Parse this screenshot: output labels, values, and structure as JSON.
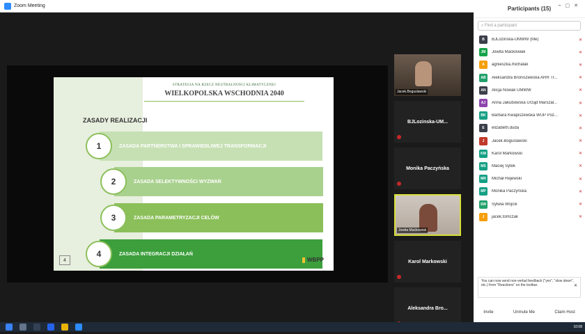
{
  "window": {
    "title": "Zoom Meeting"
  },
  "slide": {
    "subtitle": "STRATEGIA NA RZECZ NEUTRALNOŚCI KLIMATYCZNEJ",
    "title": "WIELKOPOLSKA WSCHODNIA 2040",
    "section": "ZASADY REALIZACJI",
    "items": [
      {
        "num": "1",
        "label": "ZASADA PARTNERSTWA I SPRAWIEDLIWEJ TRANSFORMACJI"
      },
      {
        "num": "2",
        "label": "ZASADA SELEKTYWNOŚCI WYZWAŃ"
      },
      {
        "num": "3",
        "label": "ZASADA PARAMETRYZACJI CELÓW"
      },
      {
        "num": "4",
        "label": "ZASADA INTEGRACJI DZIAŁAŃ"
      }
    ],
    "page_number": "4",
    "logo": "WBPP"
  },
  "tiles": [
    {
      "name": "Jacek.Boguslawski",
      "type": "video"
    },
    {
      "name": "BJLozinska-UM...",
      "type": "name"
    },
    {
      "name": "Monika Paczyńska",
      "type": "name"
    },
    {
      "name": "Jowita Maćkowiak",
      "type": "video"
    },
    {
      "name": "Karol Markowski",
      "type": "name"
    },
    {
      "name": "Aleksandra Bro...",
      "type": "name"
    }
  ],
  "participants_panel": {
    "title": "Participants (15)",
    "search_placeholder": "Find a participant",
    "participants": [
      {
        "initials": "B",
        "name": "BJLozinska-UMWW (Me)",
        "color": "#3a3f4a"
      },
      {
        "initials": "JM",
        "name": "Jowita Maćkowiak",
        "color": "#16a34a"
      },
      {
        "initials": "A",
        "name": "agnieszka.michalak",
        "color": "#f59e0b"
      },
      {
        "initials": "AB",
        "name": "Aleksandra Broniszewska ARR Tr...",
        "color": "#22a06b"
      },
      {
        "initials": "AN",
        "name": "Alicja Nowak UMWW",
        "color": "#3a3f4a"
      },
      {
        "initials": "AJ",
        "name": "Anna Jakubowska Urząd Marszał...",
        "color": "#8e44ad"
      },
      {
        "initials": "BK",
        "name": "Barbara Kwapiszewska WUP Poz...",
        "color": "#16a085"
      },
      {
        "initials": "E",
        "name": "elizabeth.duda",
        "color": "#3a3f4a"
      },
      {
        "initials": "J",
        "name": "Jacek.Boguslawski",
        "color": "#c0392b"
      },
      {
        "initials": "KM",
        "name": "Karol Markowski",
        "color": "#16a085"
      },
      {
        "initials": "MS",
        "name": "Maciej Sytek",
        "color": "#16a085"
      },
      {
        "initials": "MR",
        "name": "Michał Rejewski",
        "color": "#16a085"
      },
      {
        "initials": "MP",
        "name": "Monika Paczyńska",
        "color": "#16a085"
      },
      {
        "initials": "SW",
        "name": "Sylwia Wojcik",
        "color": "#22a06b"
      },
      {
        "initials": "J",
        "name": "jacek.tomczak",
        "color": "#f59e0b"
      }
    ],
    "notice": "You can now send non-verbal feedback (\"yes\", \"slow down\", etc.) from \"Reactions\" on the toolbar.",
    "buttons": {
      "invite": "Invite",
      "unmute": "Unmute Me",
      "claim": "Claim Host"
    }
  },
  "taskbar": {
    "time": "10:08"
  }
}
